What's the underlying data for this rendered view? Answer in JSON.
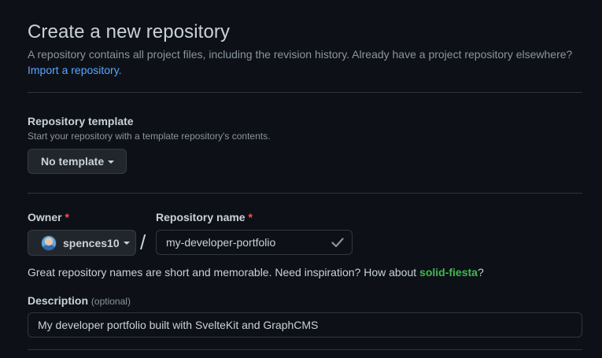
{
  "header": {
    "title": "Create a new repository",
    "subtitle": "A repository contains all project files, including the revision history. Already have a project repository elsewhere?",
    "import_link": "Import a repository."
  },
  "template": {
    "label": "Repository template",
    "hint": "Start your repository with a template repository's contents.",
    "button_label": "No template"
  },
  "owner": {
    "label": "Owner",
    "required_mark": "*",
    "value": "spences10"
  },
  "separator": "/",
  "repo_name": {
    "label": "Repository name",
    "required_mark": "*",
    "value": "my-developer-portfolio",
    "valid_icon": "check-icon"
  },
  "inspiration": {
    "text": "Great repository names are short and memorable. Need inspiration? How about ",
    "suggestion": "solid-fiesta",
    "suffix": "?"
  },
  "description": {
    "label": "Description",
    "optional": "(optional)",
    "value": "My developer portfolio built with SvelteKit and GraphCMS"
  },
  "colors": {
    "background": "#0d1117",
    "link": "#58a6ff",
    "required": "#f85149",
    "suggestion": "#3fb950",
    "border": "#30363d"
  }
}
